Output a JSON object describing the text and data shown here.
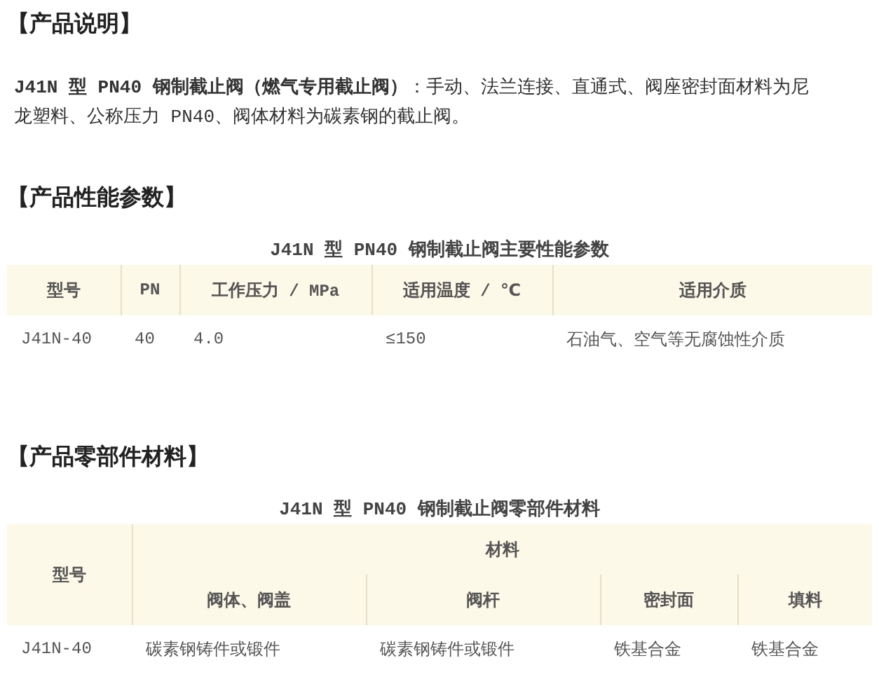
{
  "sections": [
    {
      "heading": "【产品说明】",
      "paragraph": "**J41N 型 PN40 钢制截止阀（燃气专用截止阀）**：手动、法兰连接、直通式、阀座密封面材料为尼龙塑料、公称压力 PN40、阀体材料为碳素钢的截止阀。"
    },
    {
      "heading": "【产品性能参数】",
      "table": {
        "caption": "J41N 型 PN40 钢制截止阀主要性能参数",
        "header_rows": [
          [
            {
              "text": "型号"
            },
            {
              "text": "PN"
            },
            {
              "text": "工作压力 / MPa"
            },
            {
              "text": "适用温度 / ℃"
            },
            {
              "text": "适用介质"
            }
          ]
        ],
        "rows": [
          [
            "J41N-40",
            "40",
            "4.0",
            "≤150",
            "石油气、空气等无腐蚀性介质"
          ]
        ]
      }
    },
    {
      "heading": "【产品零部件材料】",
      "table": {
        "caption": "J41N 型 PN40 钢制截止阀零部件材料",
        "header_rows": [
          [
            {
              "text": "型号",
              "rowspan": 2
            },
            {
              "text": "材料",
              "colspan": 4
            }
          ],
          [
            {
              "text": "阀体、阀盖"
            },
            {
              "text": "阀杆"
            },
            {
              "text": "密封面"
            },
            {
              "text": "填料"
            }
          ]
        ],
        "rows": [
          [
            "J41N-40",
            "碳素钢铸件或锻件",
            "碳素钢铸件或锻件",
            "铁基合金",
            "铁基合金"
          ]
        ]
      }
    }
  ]
}
